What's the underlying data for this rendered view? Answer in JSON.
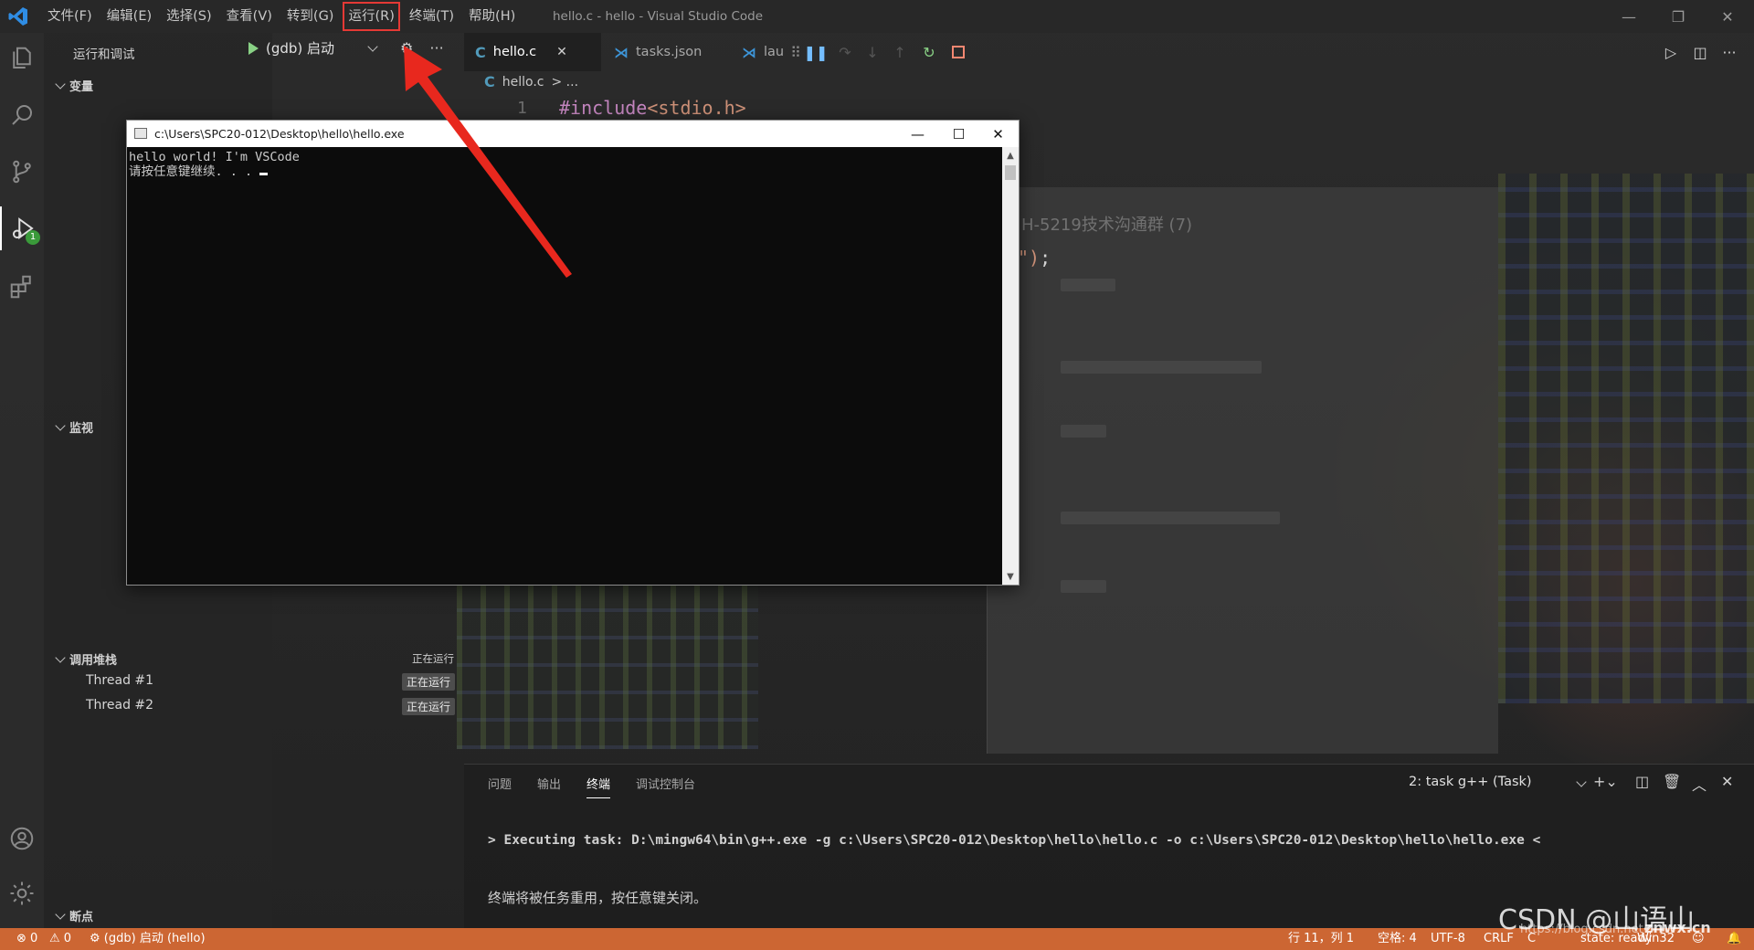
{
  "window": {
    "title": "hello.c - hello - Visual Studio Code",
    "minimize": "—",
    "restore": "❐",
    "close": "✕"
  },
  "menu": [
    {
      "label": "文件(F)"
    },
    {
      "label": "编辑(E)"
    },
    {
      "label": "选择(S)"
    },
    {
      "label": "查看(V)"
    },
    {
      "label": "转到(G)"
    },
    {
      "label": "运行(R)",
      "highlighted": true
    },
    {
      "label": "终端(T)"
    },
    {
      "label": "帮助(H)"
    }
  ],
  "activity_bar": {
    "debug_badge": "1",
    "icons": [
      "explorer-icon",
      "search-icon",
      "source-control-icon",
      "run-debug-icon",
      "extensions-icon",
      "account-icon",
      "settings-gear-icon"
    ]
  },
  "sidebar": {
    "title": "运行和调试",
    "run_config": "(gdb) 启动",
    "sections": {
      "variables": "变量",
      "watch": "监视",
      "call_stack": "调用堆栈",
      "breakpoints": "断点"
    },
    "call_stack_status": "正在运行",
    "threads": [
      {
        "name": "Thread #1",
        "status": "正在运行"
      },
      {
        "name": "Thread #2",
        "status": "正在运行"
      }
    ]
  },
  "tabs": [
    {
      "label": "hello.c",
      "active": true,
      "close": "✕"
    },
    {
      "label": "tasks.json",
      "active": false
    },
    {
      "label": "lau",
      "active": false
    }
  ],
  "editor": {
    "breadcrumb_file": "hello.c",
    "breadcrumb_rest": "> ...",
    "line_number": "1",
    "line1_keyword": "#include",
    "line1_rest": "<stdio.h>",
    "fragment_str": "\")",
    "fragment_punc": ";",
    "ghost_heading": "H-5219技术沟通群 (7)"
  },
  "console": {
    "title": "c:\\Users\\SPC20-012\\Desktop\\hello\\hello.exe",
    "line1": "hello world! I'm VSCode",
    "line2": "请按任意键继续. . . ",
    "minimize": "—",
    "maximize": "☐",
    "close": "✕"
  },
  "panel": {
    "tabs": [
      "问题",
      "输出",
      "终端",
      "调试控制台"
    ],
    "active_tab": "终端",
    "terminal_select": "2: task g++ (Task)",
    "line1": "> Executing task: D:\\mingw64\\bin\\g++.exe -g c:\\Users\\SPC20-012\\Desktop\\hello\\hello.c -o c:\\Users\\SPC20-012\\Desktop\\hello\\hello.exe <",
    "line2": "终端将被任务重用，按任意键关闭。"
  },
  "status_bar": {
    "errors": "⊗ 0",
    "warnings": "⚠ 0",
    "debug_config": "(gdb) 启动 (hello)",
    "position": "行 11，列 1",
    "spaces": "空格: 4",
    "encoding": "UTF-8",
    "eol": "CRLF",
    "language": "C",
    "state": "state: ready",
    "platform": "Win32",
    "background_color": "#cc6633"
  },
  "watermark": {
    "main": "CSDN @山语山",
    "url": "https://blog.csdn.net",
    "brand": "znwx.cn"
  },
  "colors": {
    "accent_red": "#e53935",
    "debug_green": "#89d185",
    "c_icon": "#519aba"
  }
}
